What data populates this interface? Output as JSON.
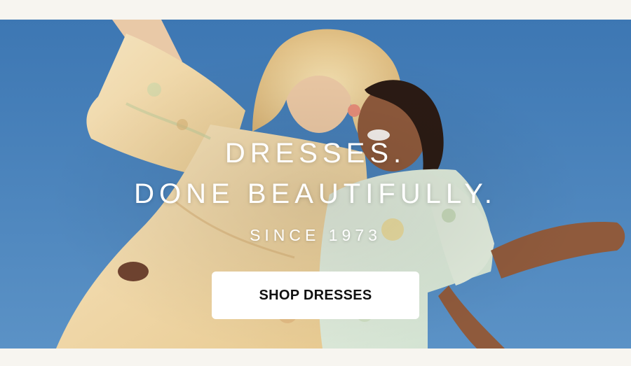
{
  "hero": {
    "headline_line1": "DRESSES.",
    "headline_line2": "DONE BEAUTIFULLY.",
    "subheadline": "SINCE 1973",
    "cta_label": "SHOP DRESSES",
    "image_alt": "Two women in floral dresses against a blue sky"
  },
  "colors": {
    "sky": "#4a84be",
    "page_background": "#f7f5f0",
    "cta_background": "#ffffff",
    "cta_text": "#111111",
    "headline_text": "#ffffff"
  }
}
